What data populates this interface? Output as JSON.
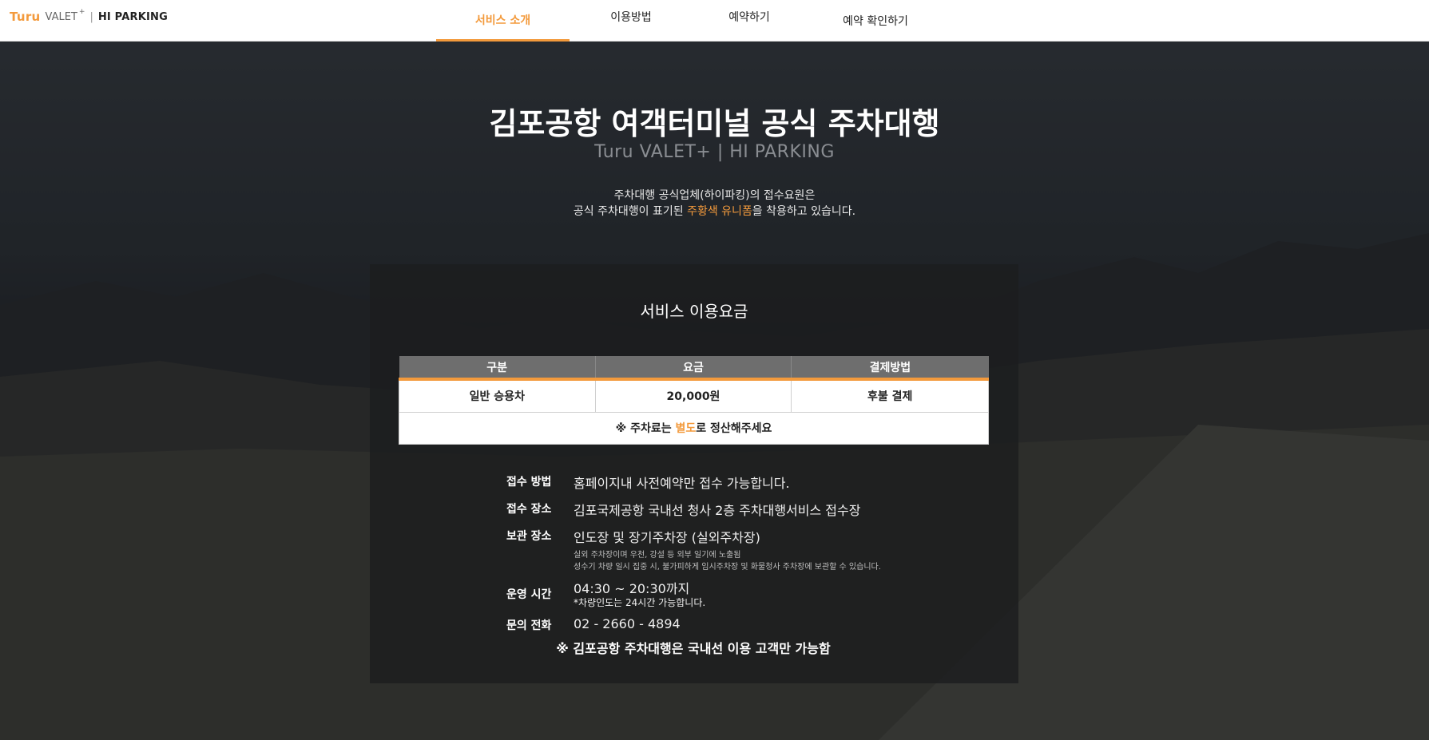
{
  "header": {
    "logo": {
      "brand": "Turu",
      "valet": "VALET",
      "plus": "+",
      "sep": "|",
      "partner": "HI PARKING"
    },
    "nav": [
      {
        "label": "서비스 소개",
        "active": true
      },
      {
        "label": "이용방법",
        "active": false
      },
      {
        "label": "예약하기",
        "active": false
      },
      {
        "label": "예약 확인하기",
        "active": false
      }
    ]
  },
  "hero": {
    "title": "김포공항 여객터미널 공식 주차대행",
    "subtitle": "Turu VALET+ | HI PARKING",
    "desc_line1": "주차대행 공식업체(하이파킹)의 접수요원은",
    "desc_line2_pre": "공식 주차대행이 표기된 ",
    "desc_line2_hl": "주황색 유니폼",
    "desc_line2_post": "을 착용하고 있습니다."
  },
  "fees": {
    "title": "서비스 이용요금",
    "headers": [
      "구분",
      "요금",
      "결제방법"
    ],
    "row": [
      "일반 승용차",
      "20,000원",
      "후불 결제"
    ],
    "note_pre": "※ 주차료는 ",
    "note_hl": "별도",
    "note_post": "로 정산해주세요"
  },
  "info": {
    "method_label": "접수 방법",
    "method_value": "홈페이지내 사전예약만 접수 가능합니다.",
    "place_label": "접수 장소",
    "place_value": "김포국제공항 국내선 청사 2층 주차대행서비스 접수장",
    "storage_label": "보관 장소",
    "storage_value": "인도장 및 장기주차장 (실외주차장)",
    "storage_note1": "실외 주차장이며 우천, 강설 등 외부 일기에 노출됨",
    "storage_note2": "성수기 차량 일시 집중 시, 불가피하게 임시주차장 및 화물청사 주차장에 보관할 수 있습니다.",
    "hours_label": "운영 시간",
    "hours_value": "04:30 ~ 20:30까지",
    "hours_note": "*차량인도는 24시간 가능합니다.",
    "phone_label": "문의 전화",
    "phone_value": "02 - 2660 - 4894",
    "final_note": "※ 김포공항 주차대행은 국내선 이용 고객만 가능함"
  },
  "colors": {
    "accent": "#f39a3c"
  }
}
